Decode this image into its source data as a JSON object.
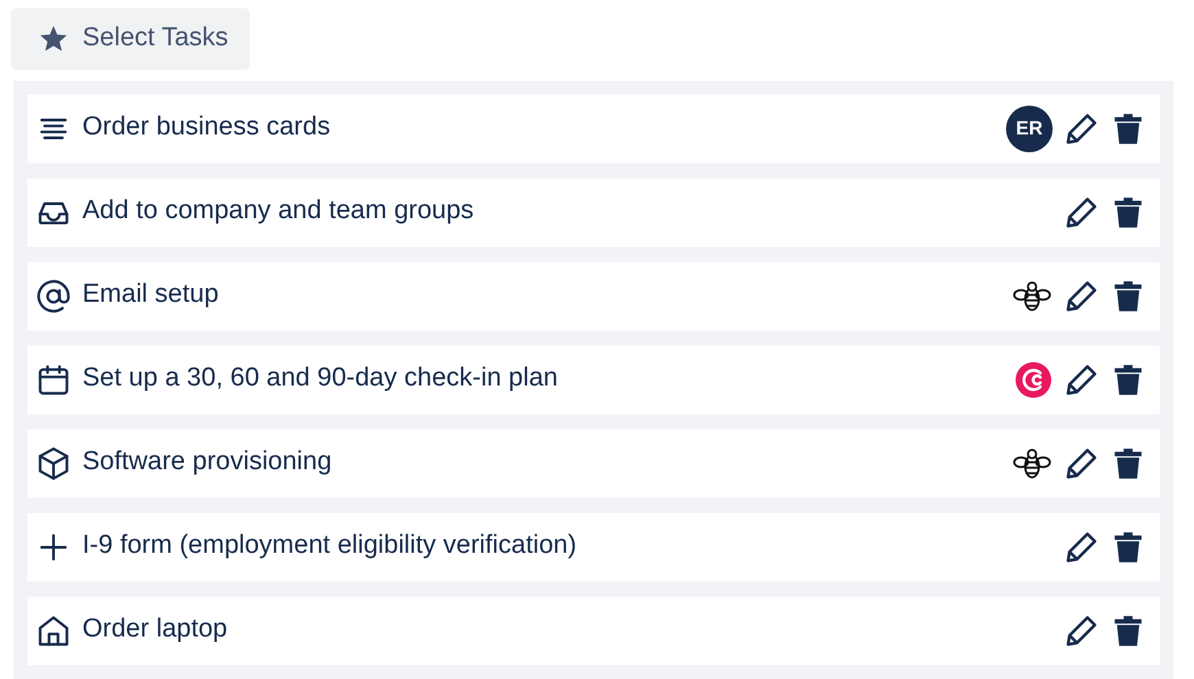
{
  "select_button": {
    "label": "Select Tasks"
  },
  "tasks": [
    {
      "kind": "lines",
      "title": "Order business cards",
      "assignee": {
        "kind": "initials",
        "text": "ER"
      }
    },
    {
      "kind": "inbox",
      "title": "Add to company and team groups"
    },
    {
      "kind": "at",
      "title": "Email setup",
      "assignee": {
        "kind": "bee"
      }
    },
    {
      "kind": "calendar",
      "title": "Set up a 30, 60 and 90-day check-in plan",
      "assignee": {
        "kind": "c-logo"
      }
    },
    {
      "kind": "cube",
      "title": "Software provisioning",
      "assignee": {
        "kind": "bee"
      }
    },
    {
      "kind": "plus",
      "title": "I-9 form (employment eligibility verification)"
    },
    {
      "kind": "home",
      "title": "Order laptop"
    }
  ]
}
